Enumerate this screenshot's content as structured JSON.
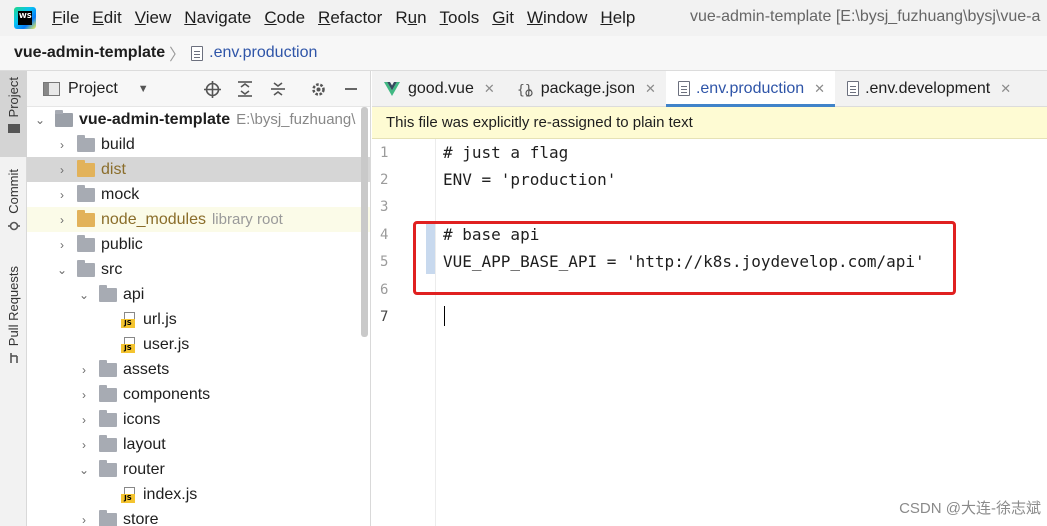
{
  "menubar": {
    "items": [
      "File",
      "Edit",
      "View",
      "Navigate",
      "Code",
      "Refactor",
      "Run",
      "Tools",
      "Git",
      "Window",
      "Help"
    ],
    "mnemonics": [
      "F",
      "E",
      "V",
      "N",
      "C",
      "R",
      "u",
      "T",
      "G",
      "W",
      "H"
    ],
    "window_title": "vue-admin-template [E:\\bysj_fuzhuang\\bysj\\vue-a"
  },
  "breadcrumb": {
    "root": "vue-admin-template",
    "file": ".env.production"
  },
  "left_strip": {
    "project": "Project",
    "commit": "Commit",
    "pull_requests": "Pull Requests"
  },
  "project_panel": {
    "title": "Project",
    "root_name": "vue-admin-template",
    "root_path": "E:\\bysj_fuzhuang\\",
    "items": [
      {
        "label": "build",
        "type": "folder",
        "level": 1,
        "expanded": false
      },
      {
        "label": "dist",
        "type": "folder-excluded",
        "level": 1,
        "expanded": false,
        "selected": true
      },
      {
        "label": "mock",
        "type": "folder",
        "level": 1,
        "expanded": false
      },
      {
        "label": "node_modules",
        "type": "folder-excluded",
        "level": 1,
        "expanded": false,
        "tag": "library root"
      },
      {
        "label": "public",
        "type": "folder",
        "level": 1,
        "expanded": false
      },
      {
        "label": "src",
        "type": "folder",
        "level": 1,
        "expanded": true
      },
      {
        "label": "api",
        "type": "folder",
        "level": 2,
        "expanded": true
      },
      {
        "label": "url.js",
        "type": "js",
        "level": 3
      },
      {
        "label": "user.js",
        "type": "js",
        "level": 3
      },
      {
        "label": "assets",
        "type": "folder",
        "level": 2,
        "expanded": false
      },
      {
        "label": "components",
        "type": "folder",
        "level": 2,
        "expanded": false
      },
      {
        "label": "icons",
        "type": "folder",
        "level": 2,
        "expanded": false
      },
      {
        "label": "layout",
        "type": "folder",
        "level": 2,
        "expanded": false
      },
      {
        "label": "router",
        "type": "folder",
        "level": 2,
        "expanded": true
      },
      {
        "label": "index.js",
        "type": "js",
        "level": 3
      },
      {
        "label": "store",
        "type": "folder",
        "level": 2,
        "expanded": false
      }
    ]
  },
  "editor": {
    "tabs": [
      {
        "label": "good.vue",
        "icon": "vue-icon",
        "active": false
      },
      {
        "label": "package.json",
        "icon": "package-json-icon",
        "active": false
      },
      {
        "label": ".env.production",
        "icon": "file-icon",
        "active": true
      },
      {
        "label": ".env.development",
        "icon": "file-icon",
        "active": false
      }
    ],
    "notice": "This file was explicitly re-assigned to plain text",
    "lines": [
      {
        "no": "1",
        "text": "# just a flag"
      },
      {
        "no": "2",
        "text": "ENV = 'production'"
      },
      {
        "no": "3",
        "text": ""
      },
      {
        "no": "4",
        "text": "# base api"
      },
      {
        "no": "5",
        "text": "VUE_APP_BASE_API = 'http://k8s.joydevelop.com/api'"
      },
      {
        "no": "6",
        "text": ""
      },
      {
        "no": "7",
        "text": ""
      }
    ],
    "current_line": "7"
  },
  "watermark": "CSDN @大连-徐志斌",
  "colors": {
    "accent": "#4083c9",
    "highlight_box": "#e02020",
    "notice_bg": "#fefbd3"
  }
}
